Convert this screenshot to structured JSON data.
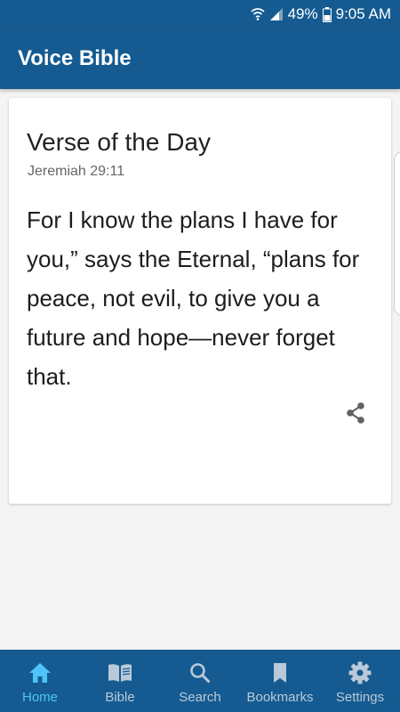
{
  "status_bar": {
    "battery": "49%",
    "time": "9:05 AM"
  },
  "app_bar": {
    "title": "Voice Bible"
  },
  "verse_card": {
    "title": "Verse of the Day",
    "reference": "Jeremiah 29:11",
    "text": "For I know the plans I have for you,” says the Eternal, “plans for peace, not evil, to give you a future and hope—never forget that."
  },
  "bottom_nav": {
    "items": [
      {
        "label": "Home",
        "icon": "home-icon",
        "active": true
      },
      {
        "label": "Bible",
        "icon": "book-icon",
        "active": false
      },
      {
        "label": "Search",
        "icon": "search-icon",
        "active": false
      },
      {
        "label": "Bookmarks",
        "icon": "bookmark-icon",
        "active": false
      },
      {
        "label": "Settings",
        "icon": "gear-icon",
        "active": false
      }
    ]
  },
  "colors": {
    "primary": "#155b91",
    "active_nav": "#4fc3f7",
    "inactive_nav": "#b9c9d9"
  }
}
